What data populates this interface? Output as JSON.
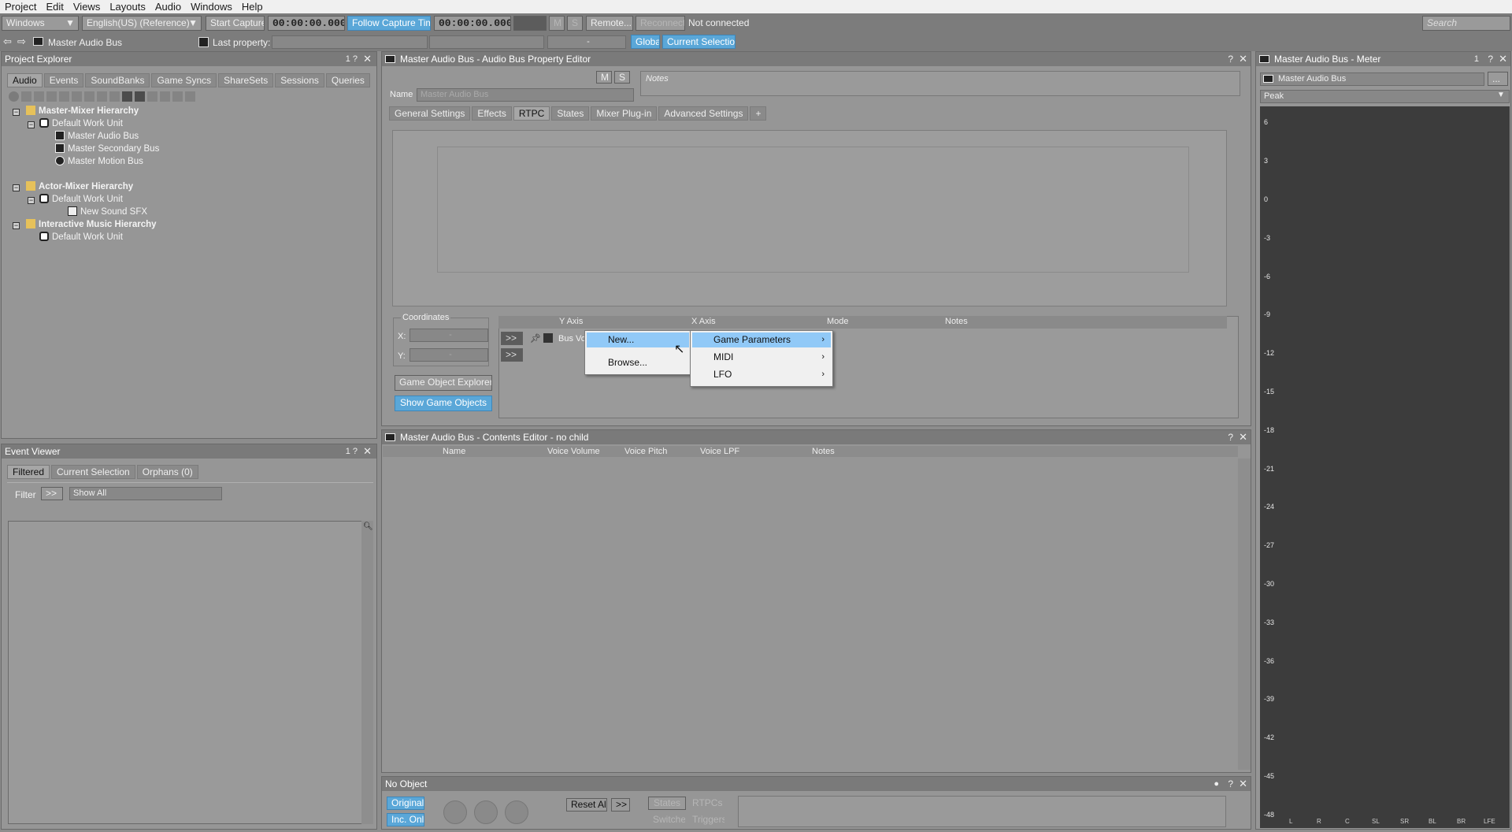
{
  "menubar": {
    "items": [
      "Project",
      "Edit",
      "Views",
      "Layouts",
      "Audio",
      "Windows",
      "Help"
    ]
  },
  "toolbar": {
    "platform": "Windows",
    "language": "English(US) (Reference)",
    "start_capture": "Start Capture",
    "time1": "00:00:00.000",
    "follow_capture": "Follow Capture Time",
    "time2": "00:00:00.000",
    "mute": "M",
    "solo": "S",
    "remote": "Remote...",
    "reconnect": "Reconnect",
    "status": "Not connected",
    "search_placeholder": "Search"
  },
  "toolbar2": {
    "current_object": "Master Audio Bus",
    "last_property_label": "Last property:",
    "dash": "-",
    "global": "Global",
    "current_selection": "Current Selection"
  },
  "project_explorer": {
    "title": "Project Explorer",
    "ctrl": "1  ?",
    "tabs": [
      "Audio",
      "Events",
      "SoundBanks",
      "Game Syncs",
      "ShareSets",
      "Sessions",
      "Queries"
    ],
    "tree": [
      {
        "label": "Master-Mixer Hierarchy",
        "bold": true
      },
      {
        "label": "Default Work Unit"
      },
      {
        "label": "Master Audio Bus"
      },
      {
        "label": "Master Secondary Bus"
      },
      {
        "label": "Master Motion Bus"
      },
      {
        "label": "Actor-Mixer Hierarchy",
        "bold": true
      },
      {
        "label": "Default Work Unit"
      },
      {
        "label": "New Sound SFX"
      },
      {
        "label": "Interactive Music Hierarchy",
        "bold": true
      },
      {
        "label": "Default Work Unit"
      }
    ]
  },
  "event_viewer": {
    "title": "Event Viewer",
    "ctrl": "1  ?",
    "tabs": [
      "Filtered",
      "Current Selection",
      "Orphans (0)"
    ],
    "filter_label": "Filter",
    "filter_btn": ">>",
    "filter_value": "Show All"
  },
  "property_editor": {
    "title": "Master Audio Bus - Audio Bus Property Editor",
    "m": "M",
    "s": "S",
    "notes_placeholder": "Notes",
    "name_label": "Name",
    "name_value": "Master Audio Bus",
    "tabs": [
      "General Settings",
      "Effects",
      "RTPC",
      "States",
      "Mixer Plug-in",
      "Advanced Settings",
      "+"
    ],
    "coordinates_label": "Coordinates",
    "x_label": "X:",
    "y_label": "Y:",
    "x_value": "-",
    "y_value": "-",
    "game_object_explorer": "Game Object Explorer...",
    "show_game_objects": "Show Game Objects",
    "rtpc_columns": [
      "Y Axis",
      "X Axis",
      "Mode",
      "Notes"
    ],
    "row_btn": ">>",
    "row_label": "Bus Vo"
  },
  "context_menu": {
    "items": [
      "New...",
      "Browse..."
    ]
  },
  "submenu": {
    "items": [
      "Game Parameters",
      "MIDI",
      "LFO"
    ]
  },
  "contents_editor": {
    "title": "Master Audio Bus - Contents Editor - no child",
    "columns": [
      "Name",
      "Voice Volume",
      "Voice Pitch",
      "Voice LPF",
      "Notes"
    ]
  },
  "transport": {
    "title": "No Object",
    "original": "Original",
    "inc_only": "Inc. Only",
    "reset_all": "Reset All",
    "more": ">>",
    "states": "States",
    "rtpcs": "RTPCs",
    "switches": "Switches",
    "triggers": "Triggers"
  },
  "meter": {
    "title": "Master Audio Bus - Meter",
    "ctrl": "1",
    "object": "Master Audio Bus",
    "more": "...",
    "mode": "Peak",
    "ticks": [
      "6",
      "3",
      "0",
      "-3",
      "-6",
      "-9",
      "-12",
      "-15",
      "-18",
      "-21",
      "-24",
      "-27",
      "-30",
      "-33",
      "-36",
      "-39",
      "-42",
      "-45",
      "-48"
    ],
    "channels": [
      "L",
      "R",
      "C",
      "SL",
      "SR",
      "BL",
      "BR",
      "LFE"
    ]
  },
  "colors": {
    "accent": "#5aa7d8",
    "menu_highlight": "#91c9f7",
    "panel": "#969696",
    "meter_bg": "#3a3a3a"
  }
}
